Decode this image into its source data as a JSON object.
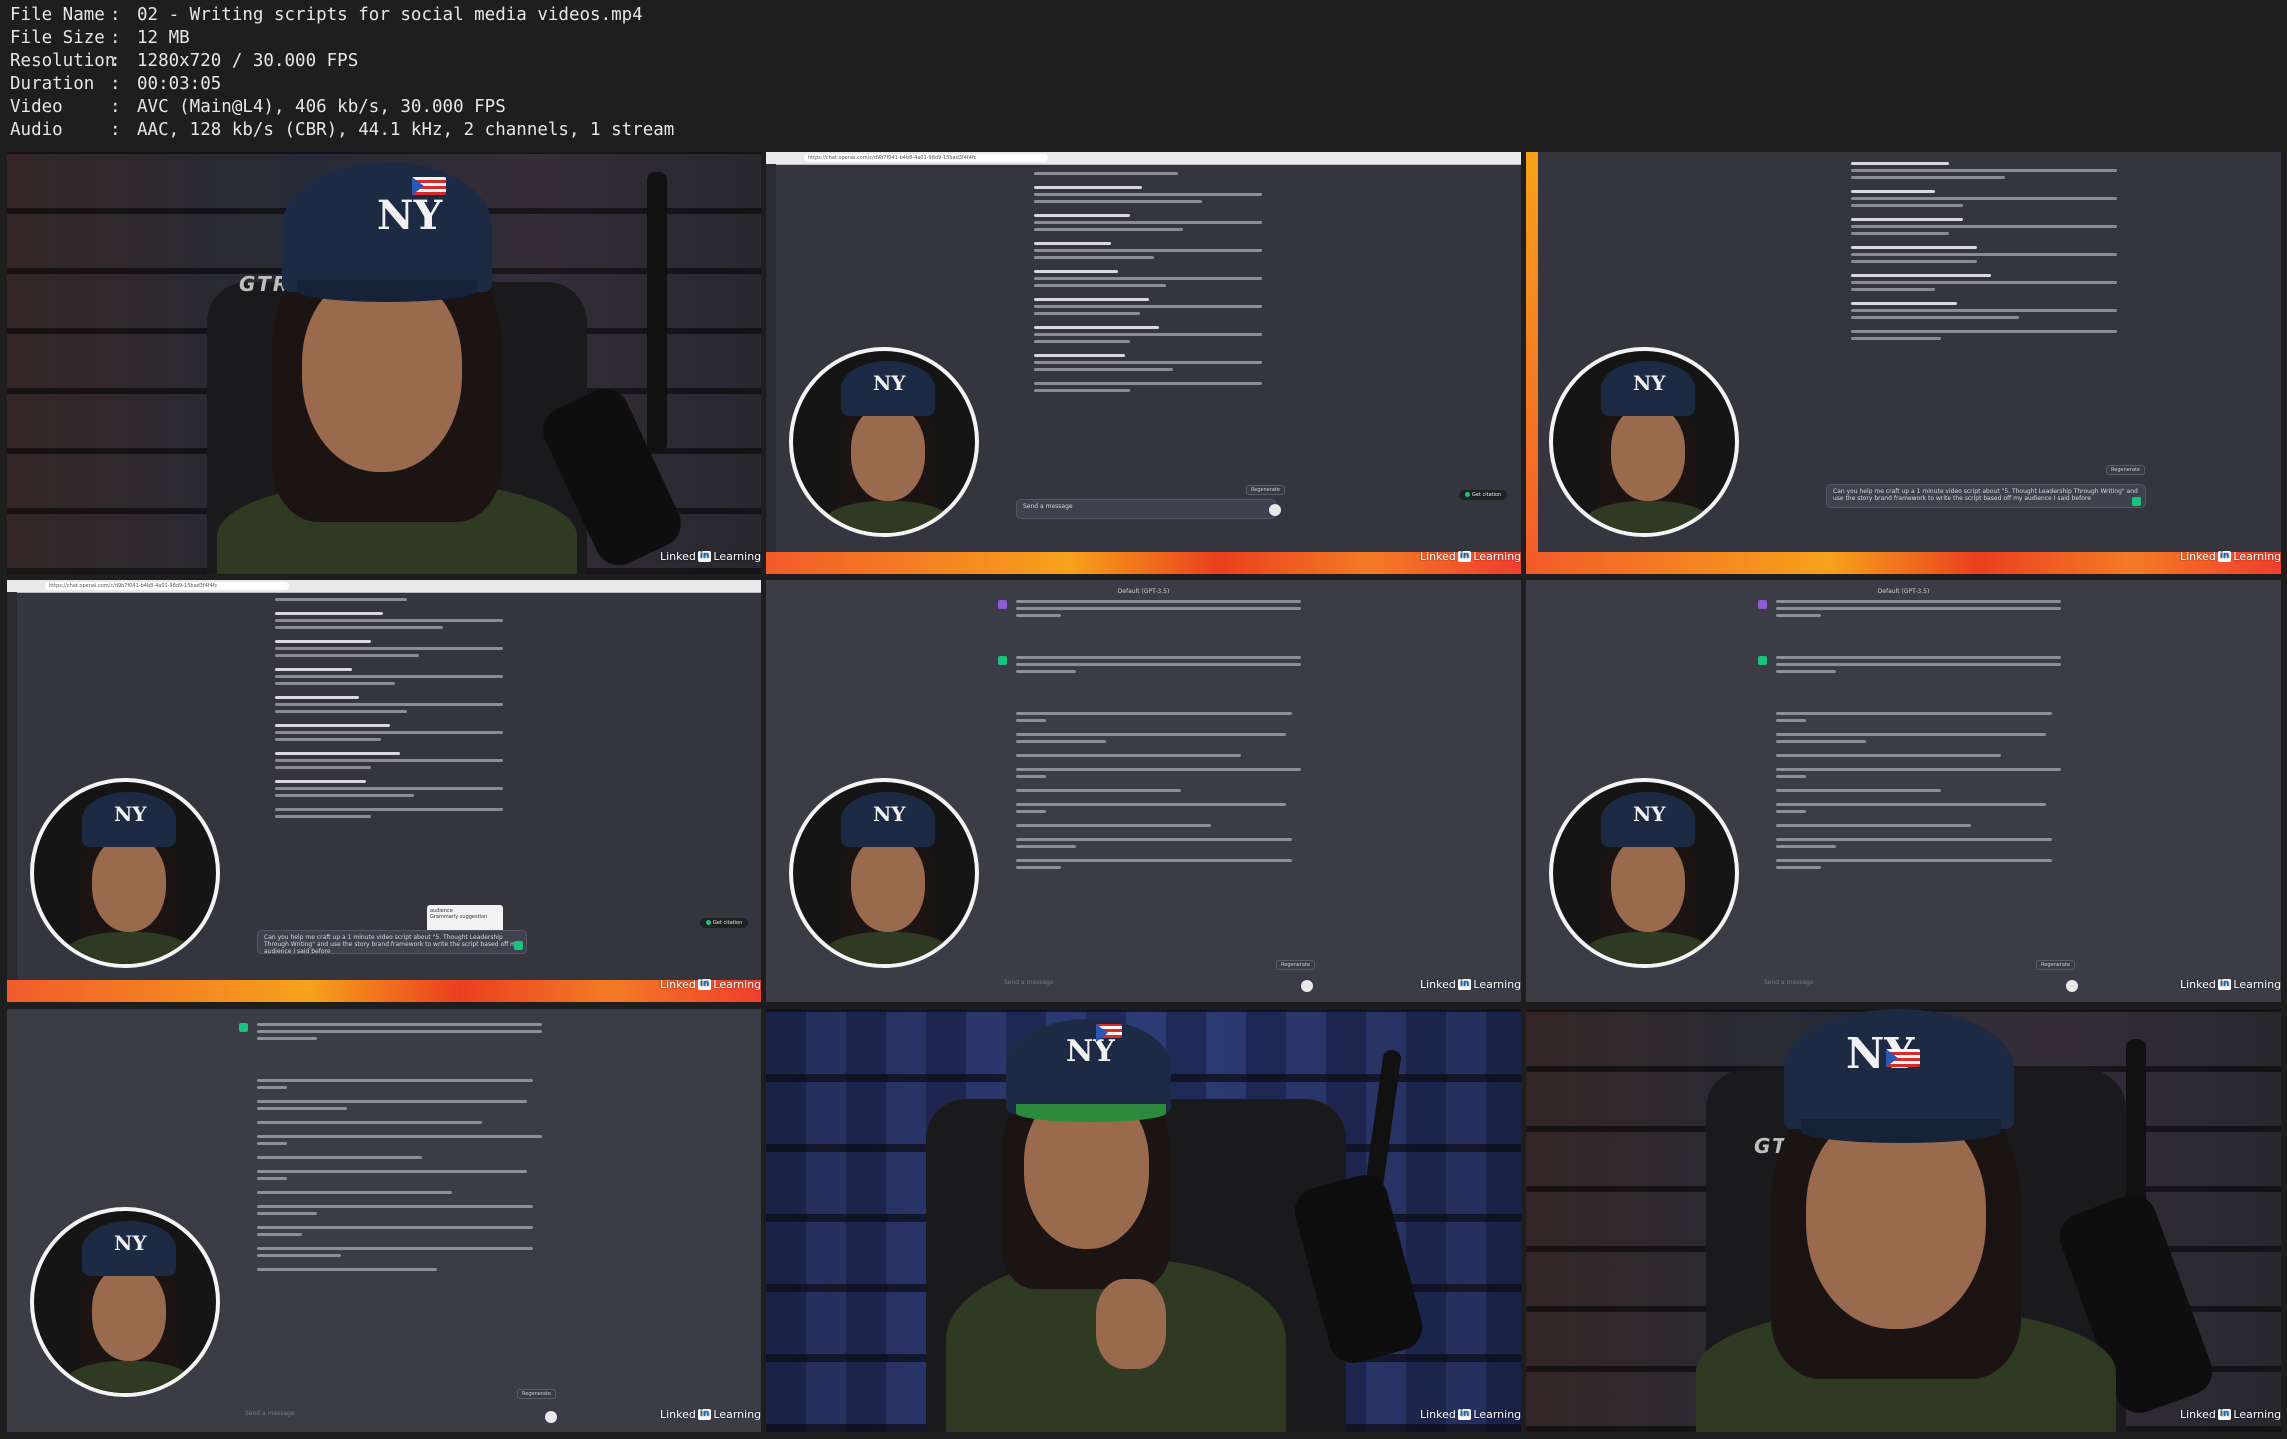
{
  "info": {
    "rows": [
      {
        "key": "File Name",
        "value": "02 - Writing scripts for social media videos.mp4"
      },
      {
        "key": "File Size",
        "value": "12 MB"
      },
      {
        "key": "Resolution",
        "value": "1280x720 / 30.000 FPS"
      },
      {
        "key": "Duration",
        "value": "00:03:05"
      },
      {
        "key": "Video",
        "value": "AVC (Main@L4), 406 kb/s, 30.000 FPS"
      },
      {
        "key": "Audio",
        "value": "AAC, 128 kb/s (CBR), 44.1 kHz, 2 channels, 1 stream"
      }
    ],
    "separator": ":"
  },
  "watermark": {
    "prefix": "Linked",
    "box": "in",
    "suffix": "Learning"
  },
  "chair_brand": "GTR",
  "cap_logo": "NY",
  "browser_url": "https://chat.openai.com/c/d9b7f041-b4b8-4a01-98d9-15bad3f4f4fc",
  "model_label": "Default (GPT-3.5)",
  "input_placeholder": "Send a message",
  "regenerate_label": "Regenerate",
  "get_citation_label": "Get citation",
  "user_prompt": "Can you help me craft up a 1 minute video script about \"5. Thought Leadership Through Writing\" and use the story brand framework to write the script based off my audience I said before",
  "autocomplete": {
    "title": "audience",
    "option": "Grammarly suggestion"
  },
  "colors": {
    "background": "#1e1e1e",
    "chat_bg": "#343541",
    "gpt_green": "#19c37d",
    "linkedin_blue": "#0a66c2"
  }
}
